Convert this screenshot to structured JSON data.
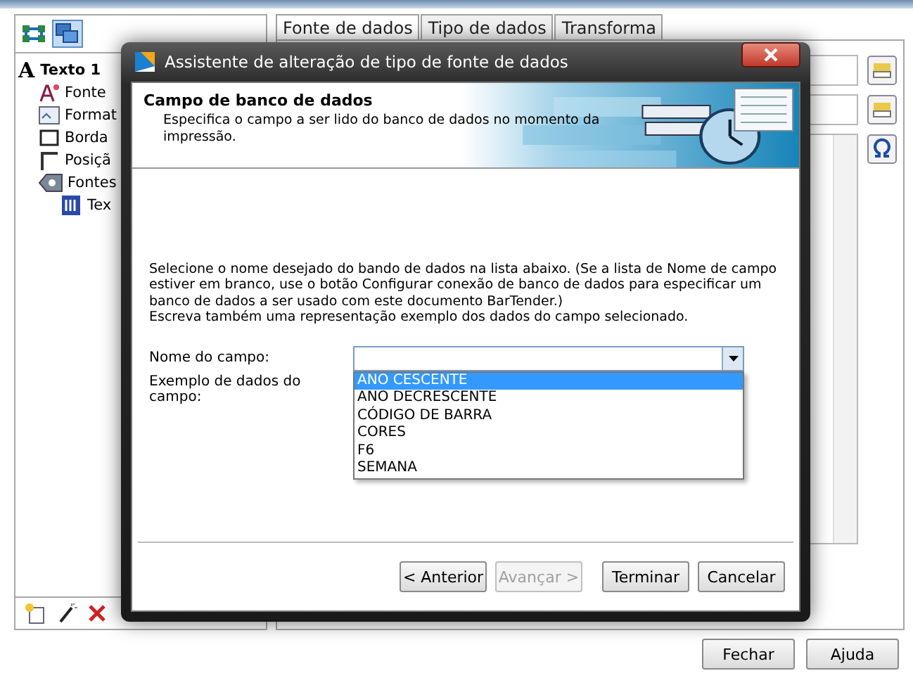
{
  "tree": {
    "icon": "A",
    "label": "Texto 1",
    "children": [
      {
        "label": "Fonte",
        "kind": "font"
      },
      {
        "label": "Format",
        "kind": "format"
      },
      {
        "label": "Borda",
        "kind": "border"
      },
      {
        "label": "Posiçã",
        "kind": "position"
      },
      {
        "label": "Fontes",
        "kind": "sources",
        "children": [
          {
            "label": "Tex",
            "kind": "text"
          }
        ]
      }
    ]
  },
  "tabs": [
    {
      "label": "Fonte de dados",
      "selected": true
    },
    {
      "label": "Tipo de dados",
      "selected": false
    },
    {
      "label": "Transforma",
      "selected": false
    }
  ],
  "dialog": {
    "title": "Assistente de alteração de tipo de fonte de dados",
    "heading": "Campo de banco de dados",
    "subheading": "Especifica o campo a ser lido do banco de dados no momento da impressão.",
    "instructions": [
      "Selecione o nome desejado do bando de dados na lista abaixo. (Se a lista de Nome de campo estiver em branco, use o botão Configurar conexão de banco de dados para especificar um banco de dados a ser usado com este documento BarTender.)",
      "Escreva também uma representação exemplo dos dados do campo selecionado."
    ],
    "field_label": "Nome do campo:",
    "sample_label": "Exemplo de dados do campo:",
    "options": [
      {
        "label": "ANO CESCENTE",
        "selected": true
      },
      {
        "label": "ANO DECRESCENTE",
        "selected": false
      },
      {
        "label": "CÓDIGO DE BARRA",
        "selected": false
      },
      {
        "label": "CORES",
        "selected": false
      },
      {
        "label": "F6",
        "selected": false
      },
      {
        "label": "SEMANA",
        "selected": false
      }
    ],
    "buttons": [
      {
        "label": "< Anterior",
        "disabled": false
      },
      {
        "label": "Avançar >",
        "disabled": true
      },
      {
        "label": "Terminar",
        "disabled": false
      },
      {
        "label": "Cancelar",
        "disabled": false
      }
    ]
  },
  "buttons": [
    "Fechar",
    "Ajuda"
  ]
}
